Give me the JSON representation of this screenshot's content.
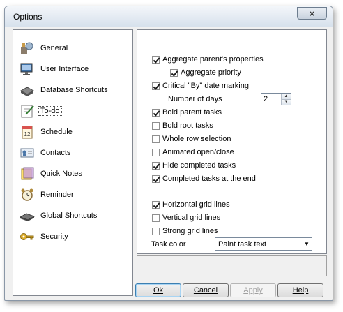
{
  "window": {
    "title": "Options",
    "close_glyph": "×"
  },
  "sidebar": {
    "items": [
      {
        "label": "General",
        "icon": "general-icon"
      },
      {
        "label": "User Interface",
        "icon": "monitor-icon"
      },
      {
        "label": "Database Shortcuts",
        "icon": "database-icon"
      },
      {
        "label": "To-do",
        "icon": "todo-icon",
        "selected": true
      },
      {
        "label": "Schedule",
        "icon": "calendar-icon"
      },
      {
        "label": "Contacts",
        "icon": "contact-card-icon"
      },
      {
        "label": "Quick Notes",
        "icon": "notes-icon"
      },
      {
        "label": "Reminder",
        "icon": "alarm-clock-icon"
      },
      {
        "label": "Global Shortcuts",
        "icon": "keyboard-icon"
      },
      {
        "label": "Security",
        "icon": "key-icon"
      }
    ]
  },
  "todo": {
    "aggregate_parent": {
      "label": "Aggregate parent's properties",
      "checked": true
    },
    "aggregate_priority": {
      "label": "Aggregate priority",
      "checked": true
    },
    "critical_by": {
      "label": "Critical \"By\" date marking",
      "checked": true
    },
    "number_of_days": {
      "label": "Number of days",
      "value": "2"
    },
    "bold_parent": {
      "label": "Bold parent tasks",
      "checked": true
    },
    "bold_root": {
      "label": "Bold root tasks",
      "checked": false
    },
    "whole_row": {
      "label": "Whole row selection",
      "checked": false
    },
    "animated": {
      "label": "Animated open/close",
      "checked": false
    },
    "hide_completed": {
      "label": "Hide completed tasks",
      "checked": true
    },
    "completed_end": {
      "label": "Completed tasks at the end",
      "checked": true
    },
    "h_grid": {
      "label": "Horizontal grid lines",
      "checked": true
    },
    "v_grid": {
      "label": "Vertical grid lines",
      "checked": false
    },
    "strong_grid": {
      "label": "Strong grid lines",
      "checked": false
    },
    "task_color": {
      "label": "Task color",
      "value": "Paint task text"
    }
  },
  "buttons": {
    "ok": "Ok",
    "cancel": "Cancel",
    "apply": "Apply",
    "help": "Help"
  },
  "colors": {
    "accent": "#3c7fb1",
    "panel_border": "#828790"
  }
}
